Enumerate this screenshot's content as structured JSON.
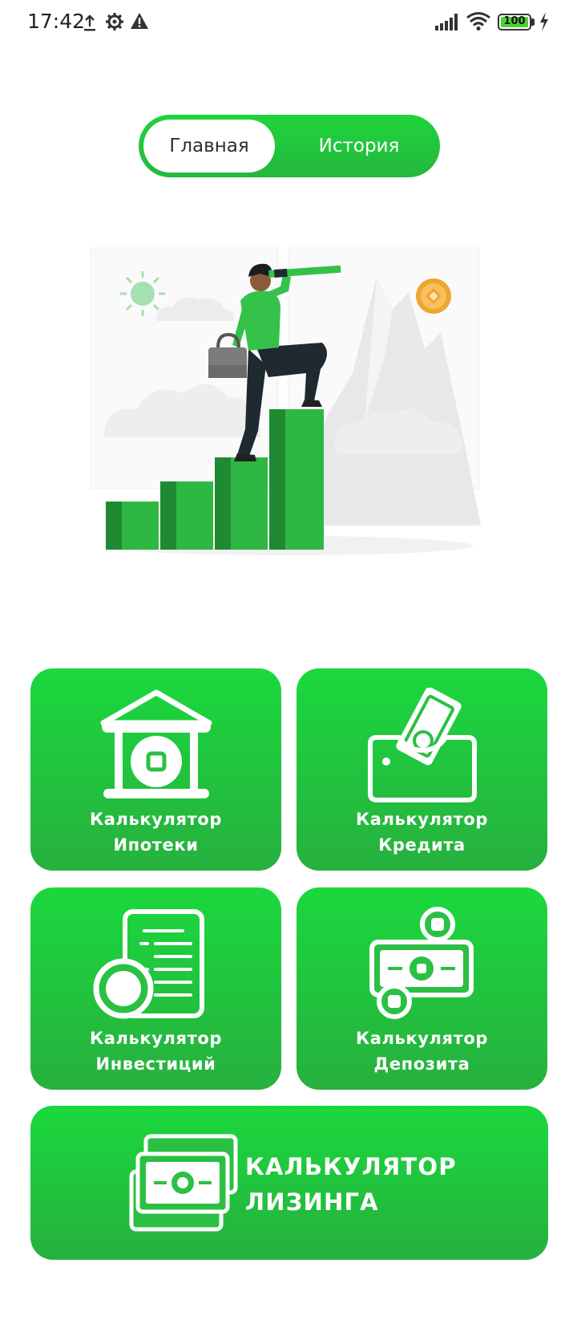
{
  "status_bar": {
    "time": "17:42",
    "battery": "100",
    "icons": [
      "upload-icon",
      "settings-gear-icon",
      "warning-icon",
      "signal-icon",
      "wifi-icon",
      "battery-icon",
      "charging-bolt-icon"
    ]
  },
  "tabs": [
    {
      "label": "Главная",
      "active": true
    },
    {
      "label": "История",
      "active": false
    }
  ],
  "colors": {
    "accent": "#1fd43c",
    "accent_dark": "#27b03f",
    "text_dark": "#2e2e2e",
    "white": "#ffffff"
  },
  "calculators": [
    {
      "line1": "Калькулятор",
      "line2": "Ипотеки",
      "icon": "bank-building-icon"
    },
    {
      "line1": "Калькулятор",
      "line2": "Кредита",
      "icon": "wallet-money-icon"
    },
    {
      "line1": "Калькулятор",
      "line2": "Инвестиций",
      "icon": "document-coin-icon"
    },
    {
      "line1": "Калькулятор",
      "line2": "Депозита",
      "icon": "banknote-coins-icon"
    }
  ],
  "leasing": {
    "line1": "КАЛЬКУЛЯТОР",
    "line2": "ЛИЗИНГА",
    "icon": "banknotes-stack-icon"
  }
}
